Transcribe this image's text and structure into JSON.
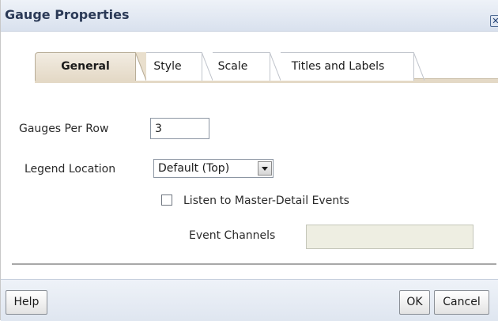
{
  "dialog": {
    "title": "Gauge Properties",
    "close_icon": "close-icon"
  },
  "tabs": [
    {
      "label": "General",
      "active": true
    },
    {
      "label": "Style",
      "active": false
    },
    {
      "label": "Scale",
      "active": false
    },
    {
      "label": "Titles and Labels",
      "active": false
    }
  ],
  "form": {
    "gauges_per_row_label": "Gauges Per Row",
    "gauges_per_row_value": "3",
    "legend_location_label": "Legend Location",
    "legend_location_value": "Default (Top)",
    "listen_label": "Listen to Master-Detail Events",
    "listen_checked": false,
    "event_channels_label": "Event Channels",
    "event_channels_value": ""
  },
  "footer": {
    "help_label": "Help",
    "ok_label": "OK",
    "cancel_label": "Cancel"
  }
}
